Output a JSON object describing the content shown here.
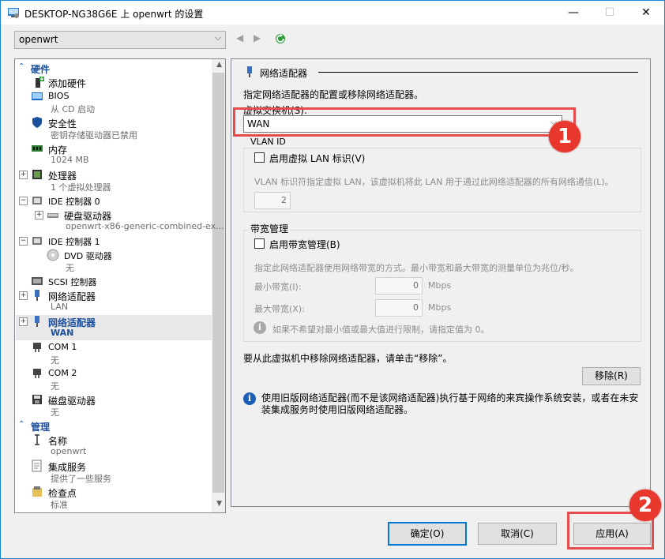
{
  "window": {
    "title": "DESKTOP-NG38G6E 上 openwrt 的设置",
    "minimize": "—",
    "maximize": "☐",
    "close": "✕"
  },
  "vm_selector": {
    "value": "openwrt"
  },
  "tree": {
    "hardware_header": "硬件",
    "items": [
      {
        "label": "添加硬件"
      },
      {
        "label": "BIOS",
        "sub": "从 CD 启动"
      },
      {
        "label": "安全性",
        "sub": "密钥存储驱动器已禁用"
      },
      {
        "label": "内存",
        "sub": "1024 MB"
      },
      {
        "label": "处理器",
        "sub": "1 个虚拟处理器"
      },
      {
        "label": "IDE 控制器 0"
      },
      {
        "label": "硬盘驱动器",
        "sub": "openwrt-x86-generic-combined-ex..."
      },
      {
        "label": "IDE 控制器 1"
      },
      {
        "label": "DVD 驱动器",
        "sub": "无"
      },
      {
        "label": "SCSI 控制器"
      },
      {
        "label": "网络适配器",
        "sub": "LAN"
      },
      {
        "label": "网络适配器",
        "sub": "WAN"
      },
      {
        "label": "COM 1",
        "sub": "无"
      },
      {
        "label": "COM 2",
        "sub": "无"
      },
      {
        "label": "磁盘驱动器",
        "sub": "无"
      }
    ],
    "management_header": "管理",
    "mgmt_items": [
      {
        "label": "名称",
        "sub": "openwrt"
      },
      {
        "label": "集成服务",
        "sub": "提供了一些服务"
      },
      {
        "label": "检查点",
        "sub": "标准"
      }
    ]
  },
  "panel": {
    "title": "网络适配器",
    "description": "指定网络适配器的配置或移除网络适配器。",
    "switch_label": "虚拟交换机(S):",
    "switch_value": "WAN",
    "vlan": {
      "group_title": "VLAN ID",
      "checkbox_label": "启用虚拟 LAN 标识(V)",
      "hint": "VLAN 标识符指定虚拟 LAN，该虚拟机将此 LAN 用于通过此网络适配器的所有网络通信(L)。",
      "value": "2"
    },
    "bandwidth": {
      "group_title": "带宽管理",
      "checkbox_label": "启用带宽管理(B)",
      "hint": "指定此网络适配器使用网络带宽的方式。最小带宽和最大带宽的测量单位为兆位/秒。",
      "min_label": "最小带宽(I):",
      "min_value": "0",
      "max_label": "最大带宽(X):",
      "max_value": "0",
      "unit": "Mbps",
      "note": "如果不希望对最小值或最大值进行限制，请指定值为 0。"
    },
    "remove_text": "要从此虚拟机中移除网络适配器，请单击“移除”。",
    "remove_button": "移除(R)",
    "legacy_info": "使用旧版网络适配器(而不是该网络适配器)执行基于网络的来宾操作系统安装，或者在未安装集成服务时使用旧版网络适配器。"
  },
  "footer": {
    "ok": "确定(O)",
    "cancel": "取消(C)",
    "apply": "应用(A)"
  },
  "annotations": {
    "badge1": "1",
    "badge2": "2"
  },
  "colors": {
    "accent": "#0078d7",
    "highlight": "#e74c4c",
    "header": "#1c4f9c"
  }
}
